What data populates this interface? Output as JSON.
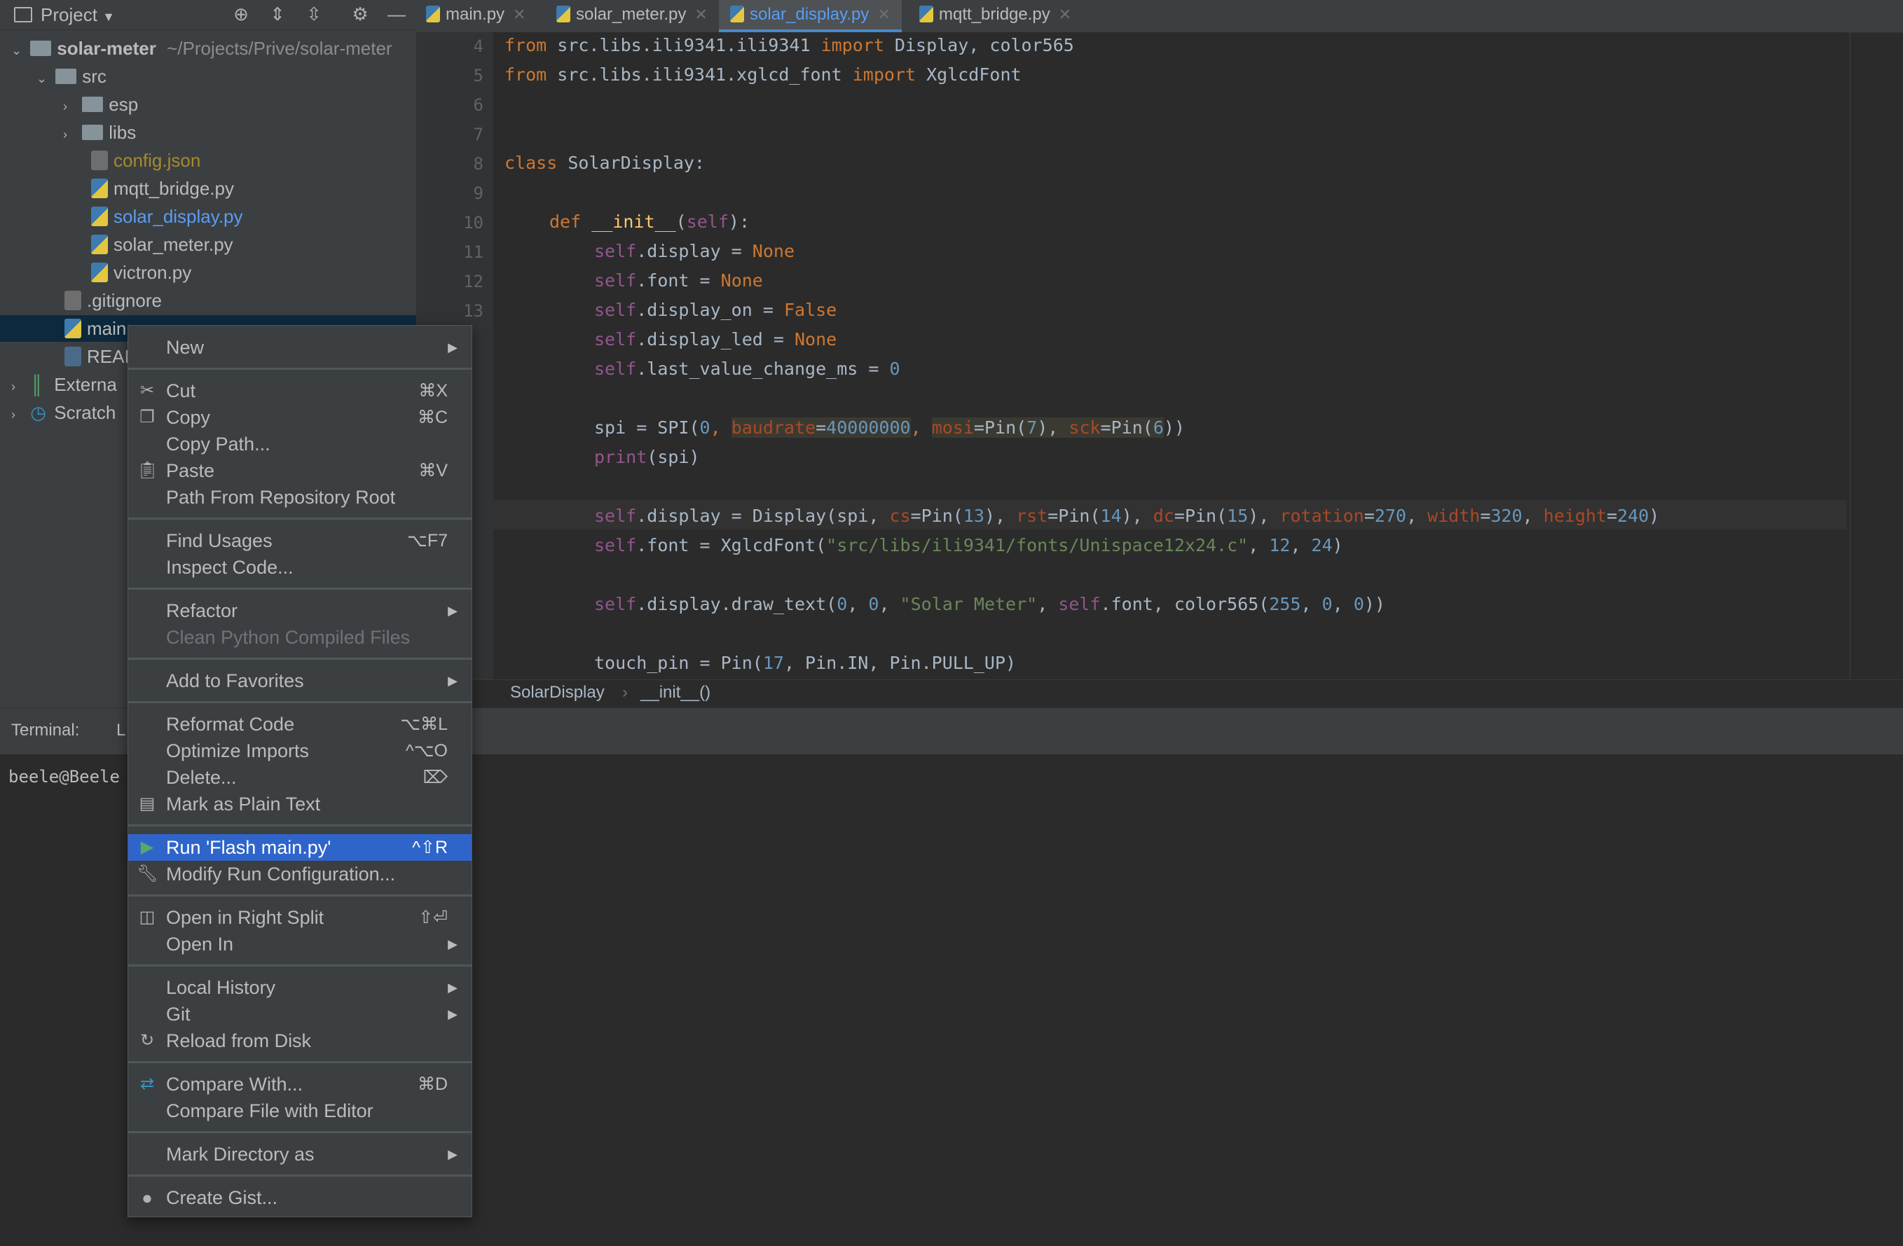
{
  "project": {
    "title": "Project",
    "root": {
      "name": "solar-meter",
      "path": "~/Projects/Prive/solar-meter"
    },
    "items": [
      {
        "label": "src"
      },
      {
        "label": "esp"
      },
      {
        "label": "libs"
      },
      {
        "label": "config.json"
      },
      {
        "label": "mqtt_bridge.py"
      },
      {
        "label": "solar_display.py"
      },
      {
        "label": "solar_meter.py"
      },
      {
        "label": "victron.py"
      },
      {
        "label": ".gitignore"
      },
      {
        "label": "main.py"
      },
      {
        "label": "REAI"
      },
      {
        "label": "Externa"
      },
      {
        "label": "Scratch"
      }
    ]
  },
  "tabs": [
    {
      "label": "main.py"
    },
    {
      "label": "solar_meter.py"
    },
    {
      "label": "solar_display.py"
    },
    {
      "label": "mqtt_bridge.py"
    }
  ],
  "editor": {
    "line_numbers": [
      "4",
      "5",
      "6",
      "7",
      "8",
      "9",
      "10",
      "11",
      "12",
      "13"
    ],
    "lines": {
      "l4a": "from",
      "l4b": " src.libs.ili9341.ili9341 ",
      "l4c": "import",
      "l4d": " Display, color565",
      "l5a": "from",
      "l5b": " src.libs.ili9341.xglcd_font ",
      "l5c": "import",
      "l5d": " XglcdFont",
      "l8a": "class",
      "l8b": " SolarDisplay:",
      "l10a": "def",
      "l10b": "__init__",
      "l10c": "(",
      "l10d": "self",
      "l10e": "):",
      "self": "self",
      "l11a": ".display = ",
      "l11b": "None",
      "l12a": ".font = ",
      "l12b": "None",
      "l13a": ".display_on = ",
      "l13b": "False",
      "l14a": ".display_led = ",
      "l14b": "None",
      "l15a": ".last_value_change_ms = ",
      "l15b": "0",
      "l17a": "spi = SPI(",
      "l17b": "0",
      "l17c": ", ",
      "l17d": "baudrate",
      "l17e": "=",
      "l17f": "40000000",
      "l17g": ", ",
      "l17h": "mosi",
      "l17i": "=Pin(",
      "l17j": "7",
      "l17k": "), ",
      "l17l": "sck",
      "l17m": "=Pin(",
      "l17n": "6",
      "l17o": "))",
      "l18a": "print",
      "l18b": "(spi)",
      "l20a": ".display = Display(spi, ",
      "l20b": "cs",
      "l20c": "=Pin(",
      "l20d": "13",
      "l20e": "), ",
      "l20f": "rst",
      "l20g": "=Pin(",
      "l20h": "14",
      "l20i": "), ",
      "l20j": "dc",
      "l20k": "=Pin(",
      "l20l": "15",
      "l20m": "), ",
      "l20n": "rotation",
      "l20o": "=",
      "l20p": "270",
      "l20q": ", ",
      "l20r": "width",
      "l20s": "=",
      "l20t": "320",
      "l20u": ", ",
      "l20v": "height",
      "l20w": "=",
      "l20x": "240",
      "l20y": ")",
      "l21a": ".font = XglcdFont(",
      "l21b": "\"src/libs/ili9341/fonts/Unispace12x24.c\"",
      "l21c": ", ",
      "l21d": "12",
      "l21e": ", ",
      "l21f": "24",
      "l21g": ")",
      "l23a": ".display.draw_text(",
      "l23b": "0",
      "l23c": ", ",
      "l23d": "0",
      "l23e": ", ",
      "l23f": "\"Solar Meter\"",
      "l23g": ", ",
      "l23h": ".font, color565(",
      "l23i": "255",
      "l23j": ", ",
      "l23k": "0",
      "l23l": ", ",
      "l23m": "0",
      "l23n": "))",
      "l25a": "touch_pin = Pin(",
      "l25b": "17",
      "l25c": ", Pin.IN, Pin.PULL_UP)"
    }
  },
  "breadcrumb": {
    "class_name": "SolarDisplay",
    "sep": "›",
    "method": "__init__()"
  },
  "terminal": {
    "label": "Terminal:",
    "tab": "L",
    "prompt": "beele@Beele"
  },
  "context_menu": {
    "new": "New",
    "cut": "Cut",
    "cut_sc": "⌘X",
    "copy": "Copy",
    "copy_sc": "⌘C",
    "copy_path": "Copy Path...",
    "paste": "Paste",
    "paste_sc": "⌘V",
    "path_from_root": "Path From Repository Root",
    "find_usages": "Find Usages",
    "find_usages_sc": "⌥F7",
    "inspect_code": "Inspect Code...",
    "refactor": "Refactor",
    "clean_python": "Clean Python Compiled Files",
    "add_favorites": "Add to Favorites",
    "reformat": "Reformat Code",
    "reformat_sc": "⌥⌘L",
    "optimize": "Optimize Imports",
    "optimize_sc": "^⌥O",
    "delete": "Delete...",
    "delete_sc": "⌦",
    "mark_plain": "Mark as Plain Text",
    "run": "Run 'Flash main.py'",
    "run_sc": "^⇧R",
    "modify_run": "Modify Run Configuration...",
    "open_right": "Open in Right Split",
    "open_right_sc": "⇧⏎",
    "open_in": "Open In",
    "local_history": "Local History",
    "git": "Git",
    "reload": "Reload from Disk",
    "compare_with": "Compare With...",
    "compare_with_sc": "⌘D",
    "compare_file": "Compare File with Editor",
    "mark_dir": "Mark Directory as",
    "create_gist": "Create Gist..."
  }
}
